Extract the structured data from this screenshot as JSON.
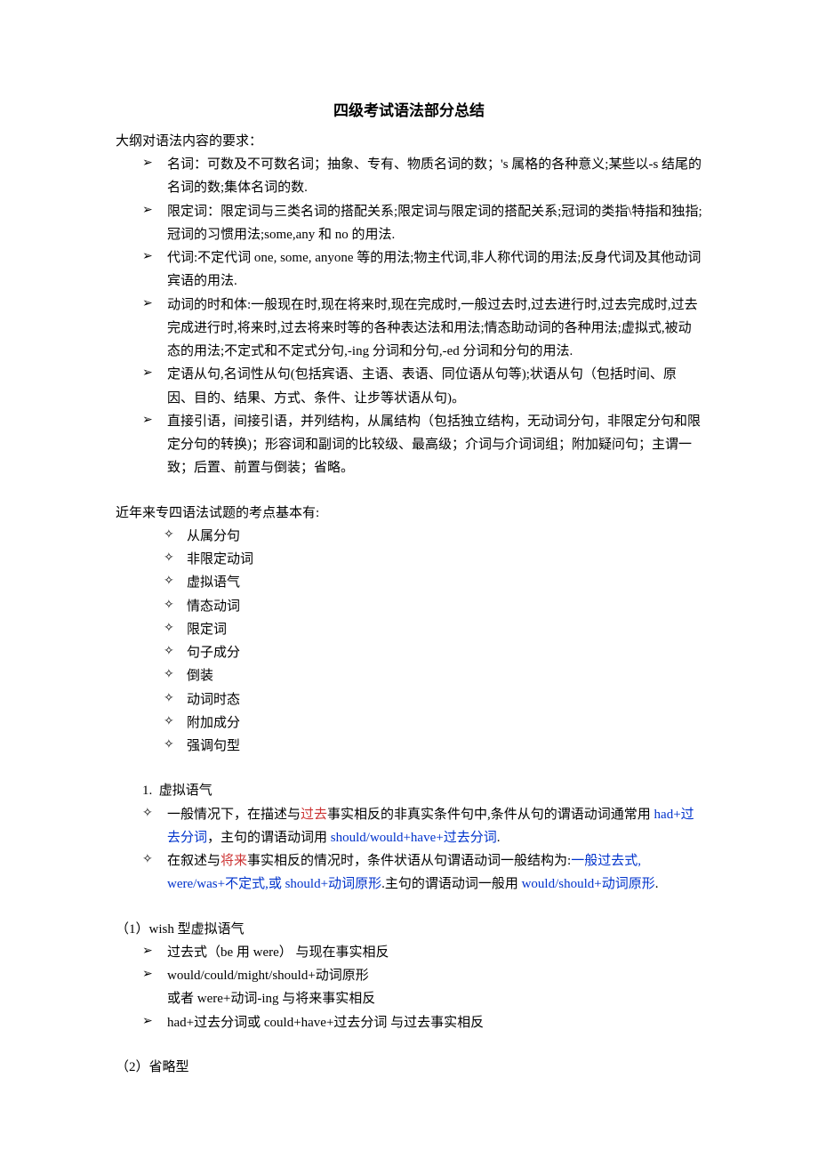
{
  "title": "四级考试语法部分总结",
  "intro": "大纲对语法内容的要求：",
  "outline": [
    "名词：可数及不可数名词；抽象、专有、物质名词的数；'s 属格的各种意义;某些以-s 结尾的名词的数;集体名词的数.",
    "限定词：限定词与三类名词的搭配关系;限定词与限定词的搭配关系;冠词的类指\\特指和独指;冠词的习惯用法;some,any 和 no 的用法.",
    "代词:不定代词 one, some, anyone 等的用法;物主代词,非人称代词的用法;反身代词及其他动词宾语的用法.",
    "动词的时和体:一般现在时,现在将来时,现在完成时,一般过去时,过去进行时,过去完成时,过去完成进行时,将来时,过去将来时等的各种表达法和用法;情态助动词的各种用法;虚拟式,被动态的用法;不定式和不定式分句,-ing 分词和分句,-ed 分词和分句的用法.",
    "定语从句,名词性从句(包括宾语、主语、表语、同位语从句等);状语从句（包括时间、原因、目的、结果、方式、条件、让步等状语从句)。",
    "直接引语，间接引语，并列结构，从属结构（包括独立结构，无动词分句，非限定分句和限定分句的转换)；形容词和副词的比较级、最高级；介词与介词词组；附加疑问句；主谓一致；后置、前置与倒装；省略。"
  ],
  "examLabel": "近年来专四语法试题的考点基本有:",
  "examPoints": [
    "从属分句",
    "非限定动词",
    "虚拟语气",
    "情态动词",
    "限定词",
    "句子成分",
    "倒装",
    "动词时态",
    "附加成分",
    "强调句型"
  ],
  "sec1": {
    "num": "1.",
    "heading": "虚拟语气",
    "p1": {
      "a": "一般情况下，在描述与",
      "b": "过去",
      "c": "事实相反的非真实条件句中,条件从句的谓语动词通常用",
      "d": "had+过去分词",
      "e": "，主句的谓语动词用 ",
      "f": "should/would+have+过去分词",
      "g": "."
    },
    "p2": {
      "a": "在叙述与",
      "b": "将来",
      "c": "事实相反的情况时，条件状语从句谓语动词一般结构为:",
      "d": "一般过去式, were/was+不定式,或 should+动词原形",
      "e": ".主句的谓语动词一般用 ",
      "f": "would/should+动词原形",
      "g": "."
    }
  },
  "sub1": {
    "label": "（1）wish 型虚拟语气",
    "items": [
      "过去式（be 用 were）  与现在事实相反",
      "would/could/might/should+动词原形",
      "had+过去分词或 could+have+过去分词   与过去事实相反"
    ],
    "extra": "或者 were+动词-ing       与将来事实相反"
  },
  "sub2": {
    "label": "（2）省略型"
  }
}
